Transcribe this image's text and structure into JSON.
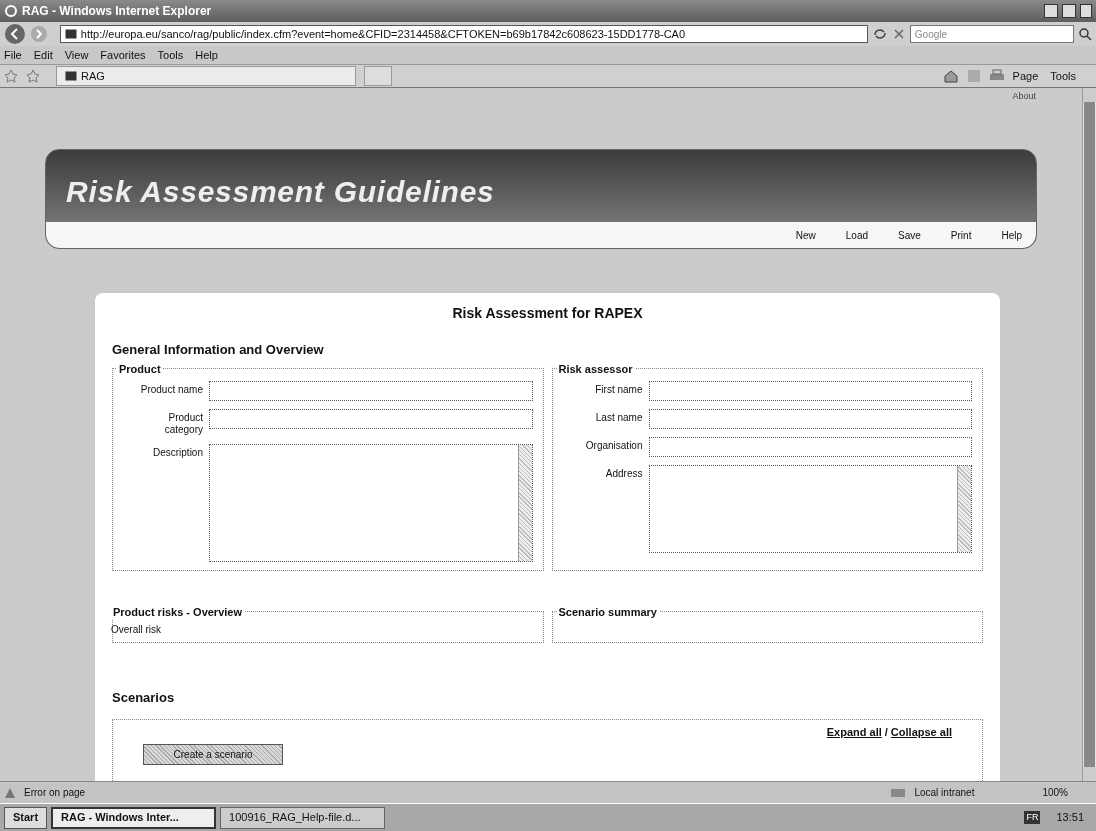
{
  "window": {
    "title": "RAG - Windows Internet Explorer"
  },
  "address_bar": {
    "url": "http://europa.eu/sanco/rag/public/index.cfm?event=home&CFID=2314458&CFTOKEN=b69b17842c608623-15DD1778-CA0",
    "search_placeholder": "Google"
  },
  "menu": [
    "File",
    "Edit",
    "View",
    "Favorites",
    "Tools",
    "Help"
  ],
  "tab": {
    "label": "RAG"
  },
  "command_bar": [
    "Page",
    "Tools"
  ],
  "page": {
    "about": "About",
    "banner_title": "Risk Assessment Guidelines",
    "nav": [
      "New",
      "Load",
      "Save",
      "Print",
      "Help"
    ],
    "form_title": "Risk Assessment for RAPEX",
    "section": "General Information and Overview",
    "fieldsets": [
      {
        "legend": "Product",
        "fields": [
          {
            "label": "Product name",
            "kind": "input"
          },
          {
            "label": "Product category",
            "kind": "input"
          },
          {
            "label": "Description",
            "kind": "textarea"
          }
        ]
      },
      {
        "legend": "Risk assessor",
        "fields": [
          {
            "label": "First name",
            "kind": "input"
          },
          {
            "label": "Last name",
            "kind": "input"
          },
          {
            "label": "Organisation",
            "kind": "input"
          },
          {
            "label": "Address",
            "kind": "textarea"
          }
        ]
      }
    ],
    "overview": {
      "legend": "Product risks - Overview",
      "text": "Overall risk"
    },
    "summary": {
      "legend": "Scenario summary"
    },
    "scenarios": {
      "heading": "Scenarios",
      "links": [
        "Expand all",
        "Collapse all"
      ],
      "separator": "/",
      "button": "Create a scenario"
    }
  },
  "status_bar": {
    "message": "Error on page",
    "zone": "Local intranet",
    "zoom": "100%"
  },
  "taskbar": {
    "start": "Start",
    "tasks": [
      {
        "label": "RAG - Windows Inter...",
        "selected": true
      },
      {
        "label": "100916_RAG_Help-file.d...",
        "selected": false
      }
    ],
    "language": "FR",
    "time": "13:51"
  }
}
